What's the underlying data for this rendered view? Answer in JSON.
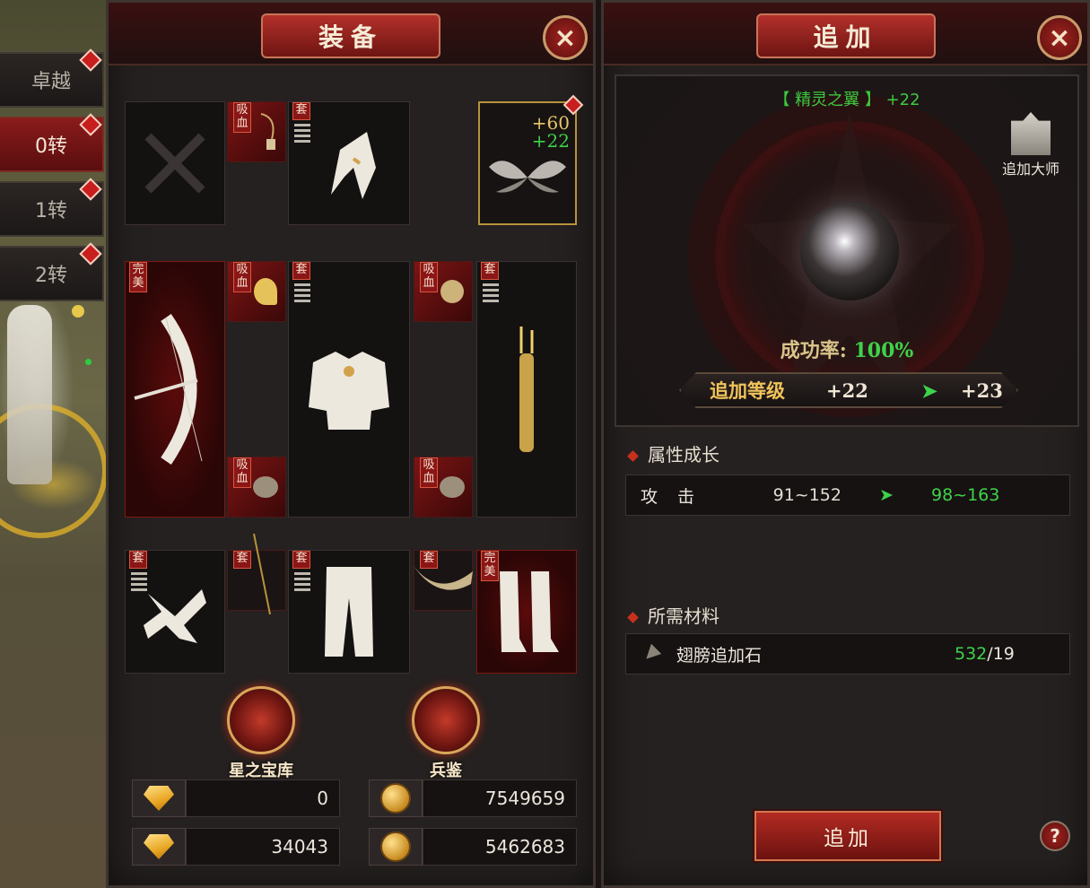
{
  "side_tabs": [
    {
      "label": "卓越",
      "active": false
    },
    {
      "label": "0转",
      "active": true
    },
    {
      "label": "1转",
      "active": false
    },
    {
      "label": "2转",
      "active": false
    }
  ],
  "equipment_panel": {
    "title": "装备",
    "close_icon": "×",
    "tags": {
      "set": "套",
      "lifesteal_top": "吸",
      "lifesteal_bottom": "血",
      "perfect_top": "完",
      "perfect_bottom": "美"
    },
    "wing_slot": {
      "plus_a": "+60",
      "plus_b": "+22"
    },
    "emblems": [
      {
        "label": "星之宝库",
        "icon": "cross-emblem-icon"
      },
      {
        "label": "兵鉴",
        "icon": "crest-emblem-icon"
      }
    ],
    "currencies": [
      {
        "icon": "gem-icon",
        "value": "0"
      },
      {
        "icon": "coin-icon",
        "value": "7549659"
      },
      {
        "icon": "bound-gem-icon",
        "value": "34043"
      },
      {
        "icon": "bound-coin-icon",
        "value": "5462683"
      }
    ]
  },
  "enhance_panel": {
    "title": "追加",
    "close_icon": "×",
    "item_name": "【 精灵之翼 】",
    "item_level": "+22",
    "master_label": "追加大师",
    "success_rate_label": "成功率:",
    "success_rate_value": "100%",
    "level_label": "追加等级",
    "level_current": "+22",
    "level_arrow": "➤",
    "level_next": "+23",
    "attr_section": "属性成长",
    "attributes": [
      {
        "name": "攻击",
        "current": "91~152",
        "arrow": "➤",
        "next": "98~163"
      }
    ],
    "material_section": "所需材料",
    "materials": [
      {
        "name": "翅膀追加石",
        "have": "532",
        "need": "/19"
      }
    ],
    "action_button": "追加",
    "help_icon": "?"
  }
}
